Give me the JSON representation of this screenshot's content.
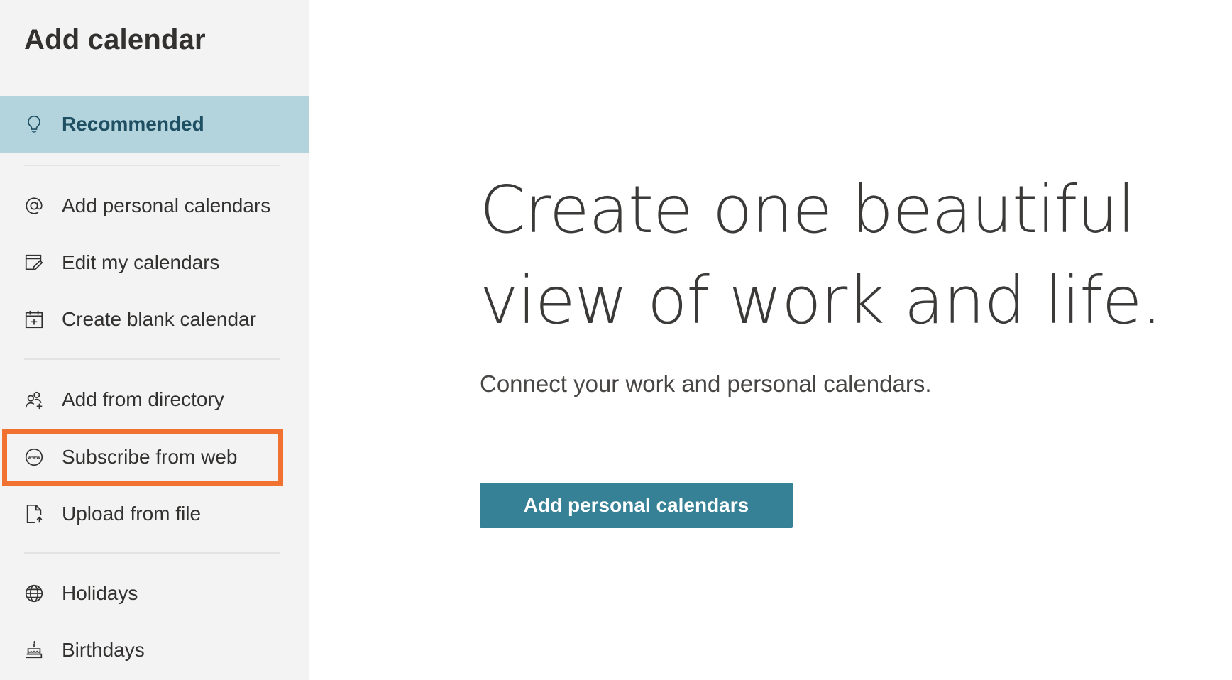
{
  "sidebar": {
    "title": "Add calendar",
    "items": [
      {
        "label": "Recommended",
        "icon": "lightbulb-icon",
        "selected": true
      },
      {
        "label": "Add personal calendars",
        "icon": "at-sign-icon"
      },
      {
        "label": "Edit my calendars",
        "icon": "edit-calendar-icon"
      },
      {
        "label": "Create blank calendar",
        "icon": "calendar-add-icon"
      },
      {
        "label": "Add from directory",
        "icon": "people-add-icon"
      },
      {
        "label": "Subscribe from web",
        "icon": "www-globe-icon",
        "highlighted": true
      },
      {
        "label": "Upload from file",
        "icon": "file-upload-icon"
      },
      {
        "label": "Holidays",
        "icon": "globe-icon"
      },
      {
        "label": "Birthdays",
        "icon": "cake-icon"
      }
    ]
  },
  "main": {
    "headline": "Create one beautiful view of work and life.",
    "subline": "Connect your work and personal calendars.",
    "button_label": "Add personal calendars"
  },
  "colors": {
    "sidebar_bg": "#f3f3f3",
    "selected_bg": "#b3d4dc",
    "selected_text": "#1f4f63",
    "button_bg": "#378196",
    "highlight": "#f07130"
  }
}
